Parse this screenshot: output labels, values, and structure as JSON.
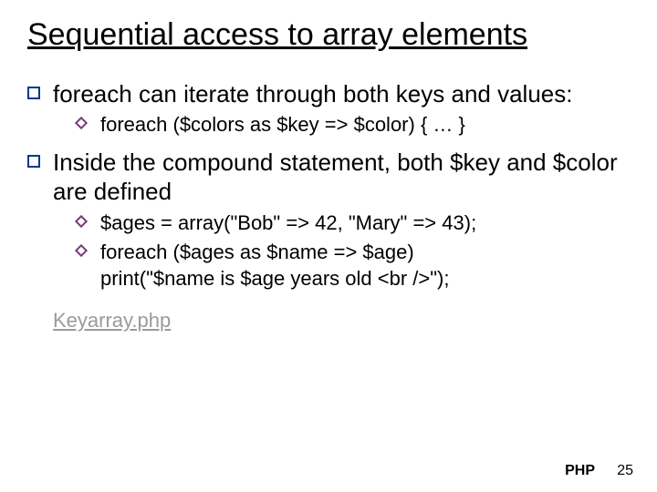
{
  "title": "Sequential access to array elements",
  "bullets": {
    "b1": {
      "text": "foreach can iterate through both keys and values:",
      "sub": {
        "s1": "foreach ($colors as $key => $color) { … }"
      }
    },
    "b2": {
      "text": "Inside the compound statement, both $key and $color are defined",
      "sub": {
        "s1": "$ages = array(\"Bob\" => 42, \"Mary\" => 43);",
        "s2": "foreach ($ages as $name => $age)",
        "s3": "print(\"$name is $age years old <br />\");"
      }
    }
  },
  "link": "Keyarray.php",
  "footer": {
    "label": "PHP",
    "page": "25"
  }
}
